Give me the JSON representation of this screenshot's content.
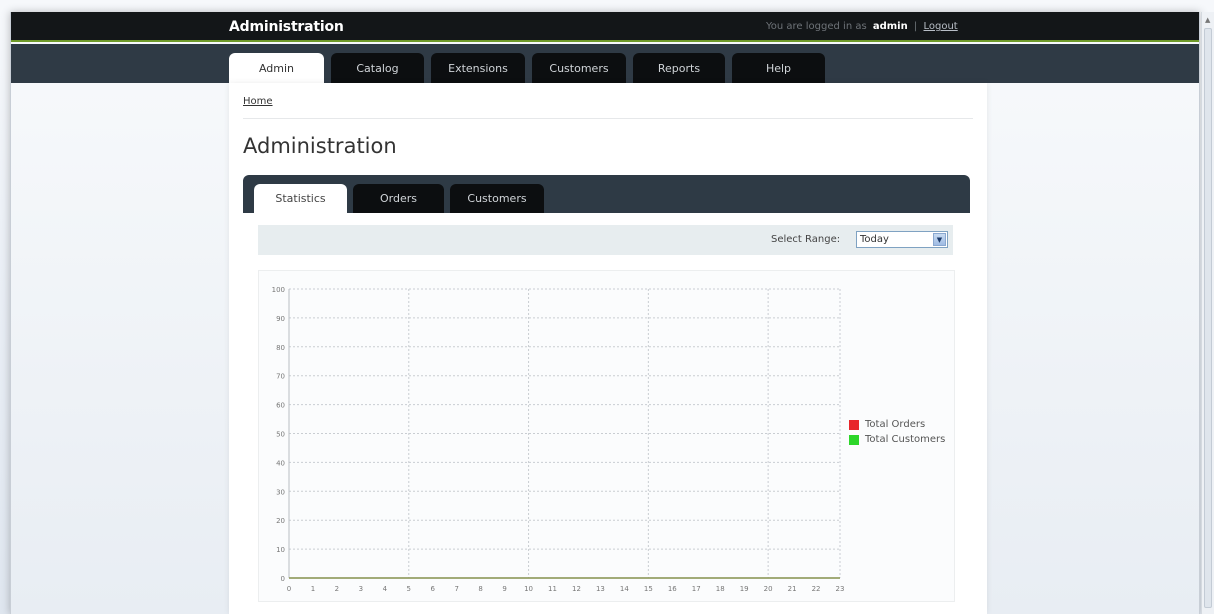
{
  "app": {
    "title": "Administration",
    "login_text": "You are logged in as",
    "username": "admin",
    "separator": "|",
    "logout": "Logout"
  },
  "main_tabs": [
    {
      "label": "Admin",
      "active": true
    },
    {
      "label": "Catalog",
      "active": false
    },
    {
      "label": "Extensions",
      "active": false
    },
    {
      "label": "Customers",
      "active": false
    },
    {
      "label": "Reports",
      "active": false
    },
    {
      "label": "Help",
      "active": false
    }
  ],
  "breadcrumb": {
    "home": "Home"
  },
  "page": {
    "title": "Administration"
  },
  "sub_tabs": [
    {
      "label": "Statistics",
      "active": true
    },
    {
      "label": "Orders",
      "active": false
    },
    {
      "label": "Customers",
      "active": false
    }
  ],
  "filter": {
    "label": "Select Range:",
    "selected": "Today",
    "arrow_icon": "dropdown-arrow-icon"
  },
  "chart_data": {
    "type": "line",
    "x": [
      0,
      1,
      2,
      3,
      4,
      5,
      6,
      7,
      8,
      9,
      10,
      11,
      12,
      13,
      14,
      15,
      16,
      17,
      18,
      19,
      20,
      21,
      22,
      23
    ],
    "y_ticks": [
      0,
      10,
      20,
      30,
      40,
      50,
      60,
      70,
      80,
      90,
      100
    ],
    "ylim": [
      0,
      100
    ],
    "xlim": [
      0,
      23
    ],
    "grid": true,
    "legend_position": "right",
    "series": [
      {
        "name": "Total Orders",
        "color": "#e8262a",
        "values": [
          0,
          0,
          0,
          0,
          0,
          0,
          0,
          0,
          0,
          0,
          0,
          0,
          0,
          0,
          0,
          0,
          0,
          0,
          0,
          0,
          0,
          0,
          0,
          0
        ]
      },
      {
        "name": "Total Customers",
        "color": "#2dd62a",
        "values": [
          0,
          0,
          0,
          0,
          0,
          0,
          0,
          0,
          0,
          0,
          0,
          0,
          0,
          0,
          0,
          0,
          0,
          0,
          0,
          0,
          0,
          0,
          0,
          0
        ]
      }
    ]
  },
  "colors": {
    "topbar": "#131618",
    "accent_line": "#6f9a2a",
    "nav_band": "#2f3a45",
    "tab_dark": "#0c0e10"
  }
}
